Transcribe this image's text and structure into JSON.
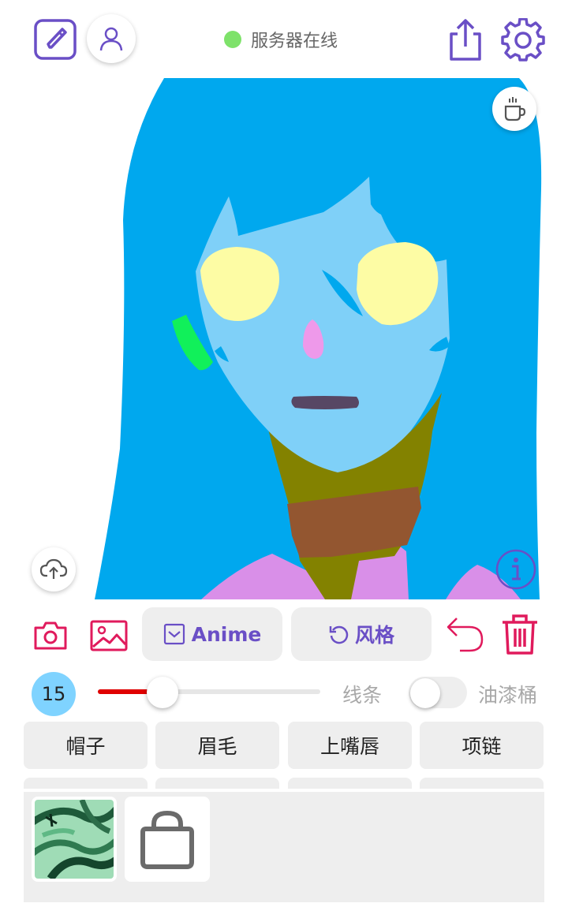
{
  "header": {
    "status_text": "服务器在线",
    "status_color": "#7ee26a",
    "icons": [
      "edit-icon",
      "user-icon",
      "share-icon",
      "settings-icon"
    ]
  },
  "canvas": {
    "icons": [
      "coffee-icon",
      "cloud-upload-icon",
      "info-icon"
    ],
    "background_color": "#00a8ee"
  },
  "toolbar": {
    "anime_label": "Anime",
    "style_label": "风格",
    "accent_color": "#6a4fc6",
    "danger_color": "#e01a5c",
    "icons": [
      "camera-icon",
      "image-icon",
      "checkbox-icon",
      "refresh-icon",
      "undo-icon",
      "trash-icon"
    ]
  },
  "brush": {
    "size": "15",
    "size_fraction": 0.29,
    "line_label": "线条",
    "bucket_label": "油漆桶",
    "bucket_enabled": false,
    "slider_color": "#e00000"
  },
  "categories": [
    "帽子",
    "眉毛",
    "上嘴唇",
    "项链"
  ],
  "tray": {
    "items": [
      "pattern-swatch",
      "bag-icon"
    ]
  }
}
